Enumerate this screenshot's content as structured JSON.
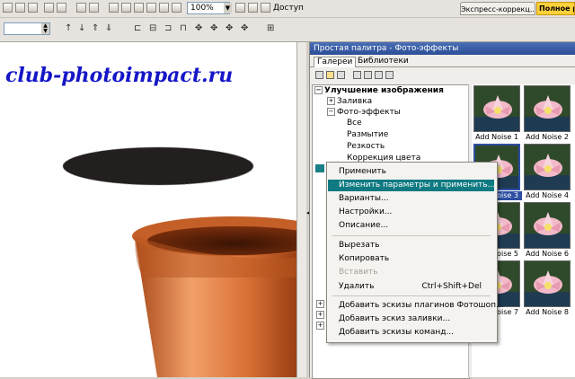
{
  "toolbar": {
    "zoom": "100%",
    "access_label": "Доступ",
    "express_tab": "Экспресс-коррекц...",
    "full_tab": "Полное ре"
  },
  "canvas": {
    "watermark": "club-photoimpact.ru"
  },
  "panel": {
    "title": "Простая палитра - Фото-эффекты",
    "tabs": [
      "Галереи",
      "Библиотеки"
    ],
    "tree": {
      "root": "Улучшение изображения",
      "fill": "Заливка",
      "photo_effects": "Фото-эффекты",
      "children": [
        "Все",
        "Размытие",
        "Резкость",
        "Коррекция цвета"
      ]
    },
    "thumbnails": [
      "Add Noise 1",
      "Add Noise 2",
      "Add Noise 3",
      "Add Noise 4",
      "Add Noise 5",
      "Add Noise 6",
      "Add Noise 7",
      "Add Noise 8"
    ],
    "selected_thumbnail": "Add Noise 3"
  },
  "context_menu": {
    "apply": "Применить",
    "edit_apply": "Изменить параметры и применить...",
    "variants": "Варианты...",
    "settings": "Настройки...",
    "description": "Описание...",
    "cut": "Вырезать",
    "copy": "Копировать",
    "paste": "Вставить",
    "delete": "Удалить",
    "delete_shortcut": "Ctrl+Shift+Del",
    "add_plugin": "Добавить эскизы плагинов Фотошоп...",
    "add_fill": "Добавить эскиз заливки...",
    "add_commands": "Добавить эскизы команд..."
  },
  "colors": {
    "highlight": "#0f7a82",
    "watermark": "#1515c8",
    "selection": "#2d4fa3",
    "title_bar": "#2c4e97"
  }
}
